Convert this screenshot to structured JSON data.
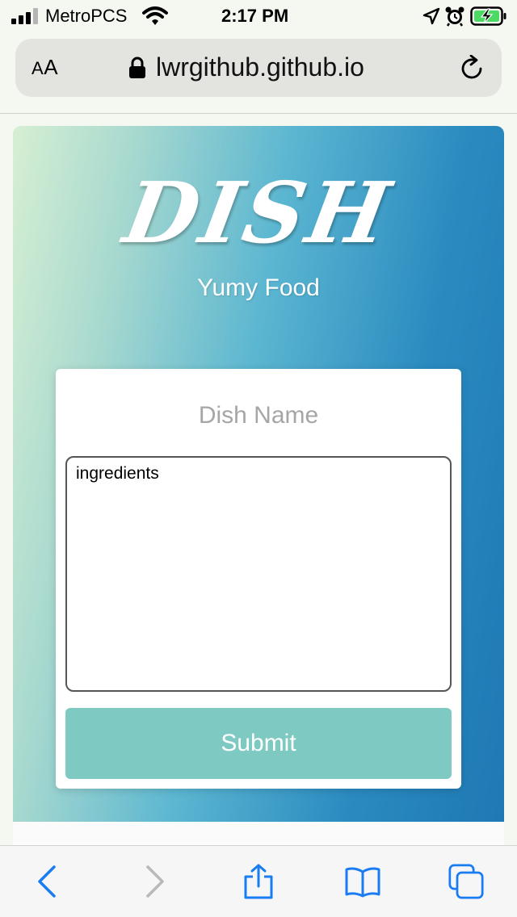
{
  "status_bar": {
    "carrier": "MetroPCS",
    "time": "2:17 PM"
  },
  "address_bar": {
    "reader_label_small": "A",
    "reader_label_large": "A",
    "url": "lwrgithub.github.io"
  },
  "page": {
    "brand": "DISH",
    "tagline": "Yumy Food",
    "form": {
      "dish_name_placeholder": "Dish Name",
      "ingredients_value": "ingredients",
      "submit_label": "Submit"
    }
  },
  "colors": {
    "accent": "#7ecac3",
    "gradient_start": "#d6efd3",
    "gradient_end": "#1f78b4",
    "ios_blue": "#1a7cf2"
  },
  "toolbar": {
    "icons": [
      "back-icon",
      "forward-icon",
      "share-icon",
      "bookmarks-icon",
      "tabs-icon"
    ]
  }
}
